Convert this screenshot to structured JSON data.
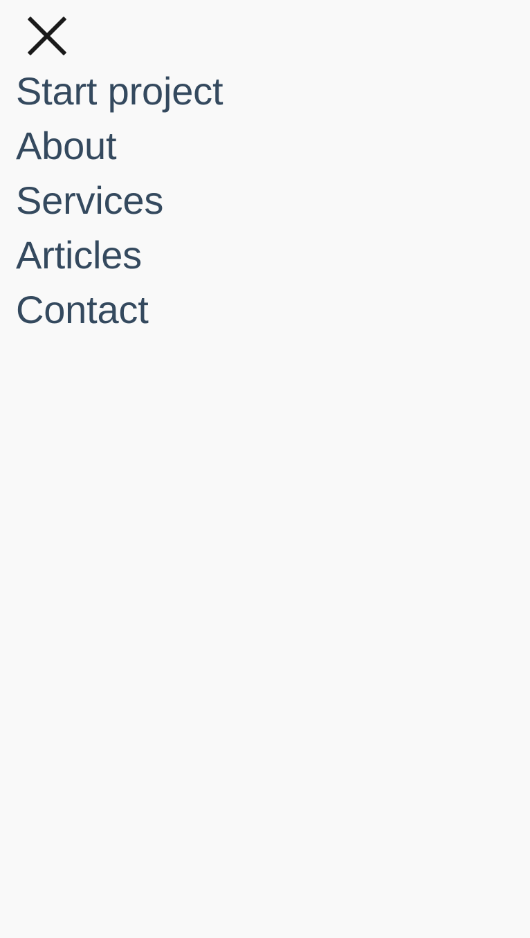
{
  "nav": {
    "close_icon": "close-icon",
    "text_color": "#34495e",
    "icon_color": "#1a1a1a",
    "background": "#f9f9f9",
    "items": [
      {
        "label": "Start project"
      },
      {
        "label": "About"
      },
      {
        "label": "Services"
      },
      {
        "label": "Articles"
      },
      {
        "label": "Contact"
      }
    ]
  }
}
